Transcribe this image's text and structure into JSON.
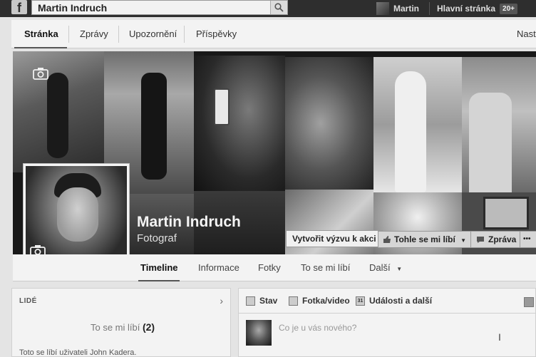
{
  "topbar": {
    "search_value": "Martin Indruch",
    "user_name": "Martin",
    "home_label": "Hlavní stránka",
    "home_badge": "20+"
  },
  "page_tabs": [
    {
      "label": "Stránka",
      "active": true
    },
    {
      "label": "Zprávy",
      "active": false
    },
    {
      "label": "Upozornění",
      "active": false
    },
    {
      "label": "Příspěvky",
      "active": false
    },
    {
      "label": "Nasta",
      "active": false
    }
  ],
  "cover": {
    "page_name": "Martin Indruch",
    "category": "Fotograf",
    "cta_button": "Vytvořit výzvu k akci",
    "like_button": "Tohle se mi líbí",
    "message_button": "Zpráva",
    "more_button": "•••"
  },
  "timeline_nav": [
    {
      "label": "Timeline",
      "active": true
    },
    {
      "label": "Informace",
      "active": false
    },
    {
      "label": "Fotky",
      "active": false
    },
    {
      "label": "To se mi líbí",
      "active": false
    },
    {
      "label": "Další",
      "active": false
    }
  ],
  "people_box": {
    "title": "LIDÉ",
    "likes_label": "To se mi líbí",
    "likes_count": "(2)",
    "liked_by": "Toto se líbí uživateli John Kadera."
  },
  "composer": {
    "status_label": "Stav",
    "photo_label": "Fotka/video",
    "event_label": "Události a další",
    "event_icon_text": "31",
    "placeholder": "Co je u vás nového?"
  }
}
